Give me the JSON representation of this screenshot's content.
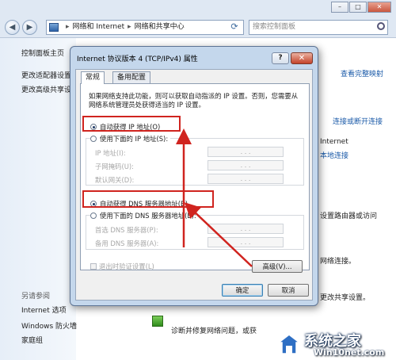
{
  "explorer": {
    "breadcrumb": [
      "网络和 Internet",
      "网络和共享中心"
    ],
    "search_placeholder": "搜索控制面板",
    "nav_back_glyph": "◀",
    "nav_forward_glyph": "▶",
    "left_links": [
      "控制面板主页",
      "更改适配器设置",
      "更改高级共享设置"
    ],
    "see_also_heading": "另请参阅",
    "see_also_items": [
      "Internet 选项",
      "Windows 防火墙",
      "家庭组"
    ],
    "right_fragments": {
      "view_full_map": "查看完整映射",
      "connect_disconnect": "连接或断开连接",
      "internet": "Internet",
      "local_connection": "本地连接",
      "setup_router": "设置路由器或访问",
      "network_connection": "网络连接。",
      "change_sharing": "更改共享设置。"
    },
    "bottom_text": "诊断并修复网络问题，或获"
  },
  "dialog": {
    "title": "Internet 协议版本 4 (TCP/IPv4) 属性",
    "help_label": "?",
    "close_label": "✕",
    "tabs": [
      "常规",
      "备用配置"
    ],
    "description": "如果网络支持此功能，则可以获取自动指派的 IP 设置。否则，您需要从网络系统管理员处获得适当的 IP 设置。",
    "ip": {
      "auto_label": "自动获得 IP 地址(O)",
      "manual_label": "使用下面的 IP 地址(S):",
      "fields": [
        "IP 地址(I):",
        "子网掩码(U):",
        "默认网关(D):"
      ]
    },
    "dns": {
      "auto_label": "自动获得 DNS 服务器地址(B)",
      "manual_label": "使用下面的 DNS 服务器地址(E):",
      "fields": [
        "首选 DNS 服务器(P):",
        "备用 DNS 服务器(A):"
      ]
    },
    "field_dots": ". . .",
    "validate_label": "退出时验证设置(L)",
    "advanced_label": "高级(V)...",
    "ok_label": "确定",
    "cancel_label": "取消"
  },
  "watermark": {
    "name": "系统之家",
    "url": "Win10net.com"
  },
  "colors": {
    "highlight": "#d0241f",
    "link": "#1a5aa8",
    "dialog_frame": "#c4d7ec"
  }
}
